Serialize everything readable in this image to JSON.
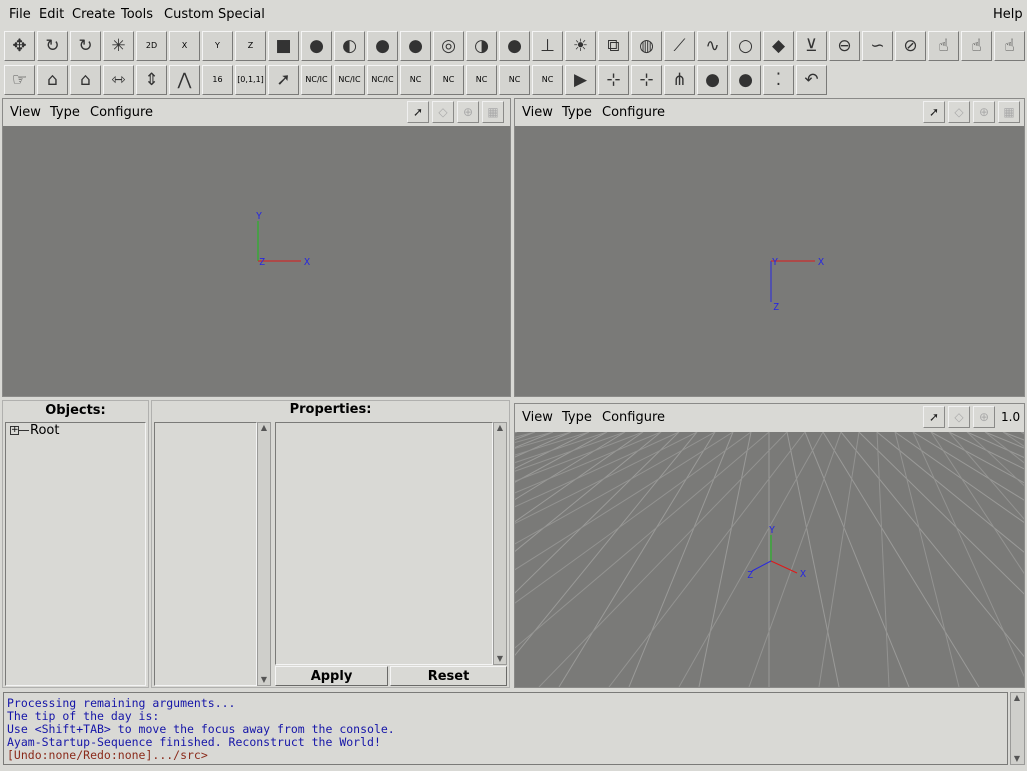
{
  "menubar": {
    "items": [
      "File",
      "Edit",
      "Create",
      "Tools",
      "Custom",
      "Special"
    ],
    "help": "Help"
  },
  "toolbar": {
    "row1": [
      {
        "icon": "move-icon"
      },
      {
        "icon": "rotate-icon"
      },
      {
        "icon": "rotate-about-icon"
      },
      {
        "icon": "scale-3d-icon"
      },
      {
        "icon": "scale-2d-icon",
        "label": "2D"
      },
      {
        "icon": "scale-x-icon",
        "label": "X"
      },
      {
        "icon": "scale-y-icon",
        "label": "Y"
      },
      {
        "icon": "scale-z-icon",
        "label": "Z"
      },
      {
        "icon": "box-icon"
      },
      {
        "icon": "sphere-icon"
      },
      {
        "icon": "cone-icon"
      },
      {
        "icon": "disk-icon"
      },
      {
        "icon": "cylinder-icon"
      },
      {
        "icon": "torus-icon"
      },
      {
        "icon": "paraboloid-icon"
      },
      {
        "icon": "hyperboloid-icon"
      },
      {
        "icon": "level-icon"
      },
      {
        "icon": "light-icon"
      },
      {
        "icon": "instance-icon"
      },
      {
        "icon": "material-icon"
      },
      {
        "icon": "ncurve-icon"
      },
      {
        "icon": "icurve-icon"
      },
      {
        "icon": "ncircle-icon"
      },
      {
        "icon": "npatch-icon"
      },
      {
        "icon": "revolve-icon"
      },
      {
        "icon": "extrude-icon"
      },
      {
        "icon": "sweep-icon"
      },
      {
        "icon": "skin-icon"
      },
      {
        "icon": "cap-icon"
      },
      {
        "icon": "bevel-icon"
      },
      {
        "icon": "birail-icon"
      },
      {
        "icon": "gordon-icon"
      }
    ],
    "row2": [
      {
        "icon": "select-points-icon"
      },
      {
        "icon": "tag-points-icon"
      },
      {
        "icon": "select-all-icon"
      },
      {
        "icon": "insert-point-icon"
      },
      {
        "icon": "delete-point-icon"
      },
      {
        "icon": "edit-weight-icon"
      },
      {
        "icon": "knot-vector-icon",
        "label": "16"
      },
      {
        "icon": "normalize-knots-icon",
        "label": "[0,1,1]"
      },
      {
        "icon": "pick-icon"
      },
      {
        "icon": "nc-ic-concat-icon",
        "label": "NC/IC"
      },
      {
        "icon": "nc-ic-split-icon",
        "label": "NC/IC"
      },
      {
        "icon": "nc-ic-revert-icon",
        "label": "NC/IC"
      },
      {
        "icon": "nc-refine-icon",
        "label": "NC"
      },
      {
        "icon": "nc-elevate-icon",
        "label": "NC"
      },
      {
        "icon": "nc-insert-knot-icon",
        "label": "NC"
      },
      {
        "icon": "nc-clamp-icon",
        "label": "NC"
      },
      {
        "icon": "nc-extend-icon",
        "label": "NC"
      },
      {
        "icon": "camera-icon"
      },
      {
        "icon": "find-u-icon"
      },
      {
        "icon": "find-uv-icon"
      },
      {
        "icon": "split-curve-icon"
      },
      {
        "icon": "light-move-icon"
      },
      {
        "icon": "objects-select-icon"
      },
      {
        "icon": "edit-points-icon"
      },
      {
        "icon": "undo-icon"
      }
    ]
  },
  "views": {
    "menu": [
      "View",
      "Type",
      "Configure"
    ],
    "front": {
      "axes": {
        "x": "X",
        "y": "Y",
        "z": "Z"
      }
    },
    "top": {
      "axes": {
        "x": "X",
        "z": "Z"
      }
    },
    "persp": {
      "axes": {
        "x": "X",
        "y": "Y",
        "z": "Z"
      },
      "zoom": "1.0"
    }
  },
  "objects": {
    "title": "Objects:",
    "root": "Root"
  },
  "properties": {
    "title": "Properties:",
    "apply": "Apply",
    "reset": "Reset"
  },
  "console": {
    "lines": [
      "Processing remaining arguments...",
      "The tip of the day is:",
      "Use <Shift+TAB> to move the focus away from the console.",
      "Ayam-Startup-Sequence finished. Reconstruct the World!"
    ],
    "prompt": "[Undo:none/Redo:none].../src>"
  },
  "colors": {
    "viewport": "#7a7a78",
    "x_axis": "#e01818",
    "y_axis": "#18c018",
    "z_axis": "#2828e0",
    "console_text": "#1515a8",
    "prompt_text": "#8a2a1a"
  }
}
